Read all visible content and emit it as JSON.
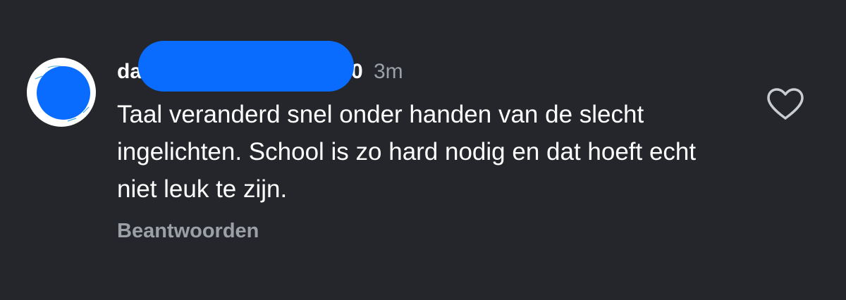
{
  "comment": {
    "username": "da",
    "username_tail": "0",
    "timestamp": "3m",
    "text": "Taal veranderd snel onder handen van de slecht ingelichten. School is zo hard nodig en dat hoeft echt niet leuk te zijn.",
    "reply_label": "Beantwoorden",
    "like_icon": "heart-outline-icon"
  },
  "colors": {
    "background": "#24262b",
    "text": "#ffffff",
    "muted": "#9ba0a8",
    "redaction": "#0a6cff"
  }
}
